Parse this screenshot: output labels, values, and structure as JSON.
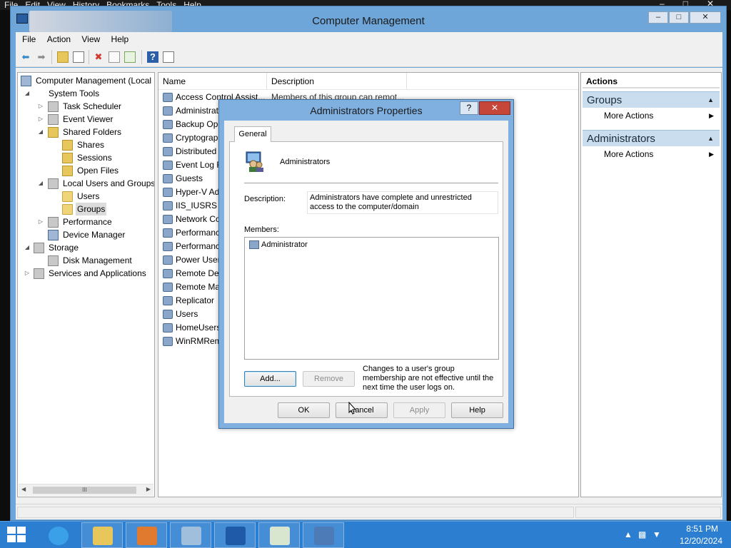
{
  "host_menu": [
    "File",
    "Edit",
    "View",
    "History",
    "Bookmarks",
    "Tools",
    "Help"
  ],
  "window": {
    "title": "Computer Management",
    "min": "‒",
    "max": "□",
    "close": "✕"
  },
  "menubar": [
    "File",
    "Action",
    "View",
    "Help"
  ],
  "toolbar": {
    "back": "⬅",
    "forward": "➡",
    "delete": "✖",
    "help": "?"
  },
  "tree": [
    {
      "label": "Computer Management (Local",
      "level": 0,
      "exp": "",
      "icon": "comp"
    },
    {
      "label": "System Tools",
      "level": 1,
      "exp": "◢",
      "icon": "tools"
    },
    {
      "label": "Task Scheduler",
      "level": 2,
      "exp": "▷",
      "icon": "grey"
    },
    {
      "label": "Event Viewer",
      "level": 2,
      "exp": "▷",
      "icon": "grey"
    },
    {
      "label": "Shared Folders",
      "level": 2,
      "exp": "◢",
      "icon": "share"
    },
    {
      "label": "Shares",
      "level": 3,
      "exp": "",
      "icon": "share"
    },
    {
      "label": "Sessions",
      "level": 3,
      "exp": "",
      "icon": "share"
    },
    {
      "label": "Open Files",
      "level": 3,
      "exp": "",
      "icon": "share"
    },
    {
      "label": "Local Users and Groups",
      "level": 2,
      "exp": "◢",
      "icon": "grey"
    },
    {
      "label": "Users",
      "level": 3,
      "exp": "",
      "icon": "folder"
    },
    {
      "label": "Groups",
      "level": 3,
      "exp": "",
      "icon": "folder",
      "selected": true
    },
    {
      "label": "Performance",
      "level": 2,
      "exp": "▷",
      "icon": "grey"
    },
    {
      "label": "Device Manager",
      "level": 2,
      "exp": "",
      "icon": "comp"
    },
    {
      "label": "Storage",
      "level": 1,
      "exp": "◢",
      "icon": "grey"
    },
    {
      "label": "Disk Management",
      "level": 2,
      "exp": "",
      "icon": "grey"
    },
    {
      "label": "Services and Applications",
      "level": 1,
      "exp": "▷",
      "icon": "grey"
    }
  ],
  "list": {
    "col_name": "Name",
    "col_desc": "Description",
    "rows": [
      {
        "name": "Access Control Assist...",
        "desc": "Members of this group can remot..."
      },
      {
        "name": "Administrat",
        "desc": ""
      },
      {
        "name": "Backup Ope",
        "desc": ""
      },
      {
        "name": "Cryptograph",
        "desc": ""
      },
      {
        "name": "Distributed C",
        "desc": ""
      },
      {
        "name": "Event Log Re",
        "desc": ""
      },
      {
        "name": "Guests",
        "desc": ""
      },
      {
        "name": "Hyper-V Adı",
        "desc": ""
      },
      {
        "name": "IIS_IUSRS",
        "desc": ""
      },
      {
        "name": "Network Co",
        "desc": ""
      },
      {
        "name": "Performance",
        "desc": ""
      },
      {
        "name": "Performance",
        "desc": ""
      },
      {
        "name": "Power Users",
        "desc": ""
      },
      {
        "name": "Remote Des",
        "desc": ""
      },
      {
        "name": "Remote Man",
        "desc": ""
      },
      {
        "name": "Replicator",
        "desc": ""
      },
      {
        "name": "Users",
        "desc": ""
      },
      {
        "name": "HomeUsers",
        "desc": ""
      },
      {
        "name": "WinRMRem",
        "desc": ""
      }
    ]
  },
  "actions": {
    "header": "Actions",
    "groups": [
      {
        "title": "Groups",
        "item": "More Actions"
      },
      {
        "title": "Administrators",
        "item": "More Actions"
      }
    ]
  },
  "dialog": {
    "title": "Administrators Properties",
    "help_btn": "?",
    "close_btn": "✕",
    "tab": "General",
    "group_name": "Administrators",
    "description_label": "Description:",
    "description_value": "Administrators have complete and unrestricted access to the computer/domain",
    "members_label": "Members:",
    "members": [
      "Administrator"
    ],
    "add": "Add...",
    "remove": "Remove",
    "note": "Changes to a user's group membership are not effective until the next time the user logs on.",
    "ok": "OK",
    "cancel": "Cancel",
    "apply": "Apply",
    "help": "Help"
  },
  "tree_scroll_label": "III",
  "clock": {
    "time": "8:51 PM",
    "date": "12/20/2024"
  },
  "colors": {
    "titlebar": "#6fa6d9",
    "taskbar": "#2c7fd0",
    "close": "#c7463a"
  }
}
